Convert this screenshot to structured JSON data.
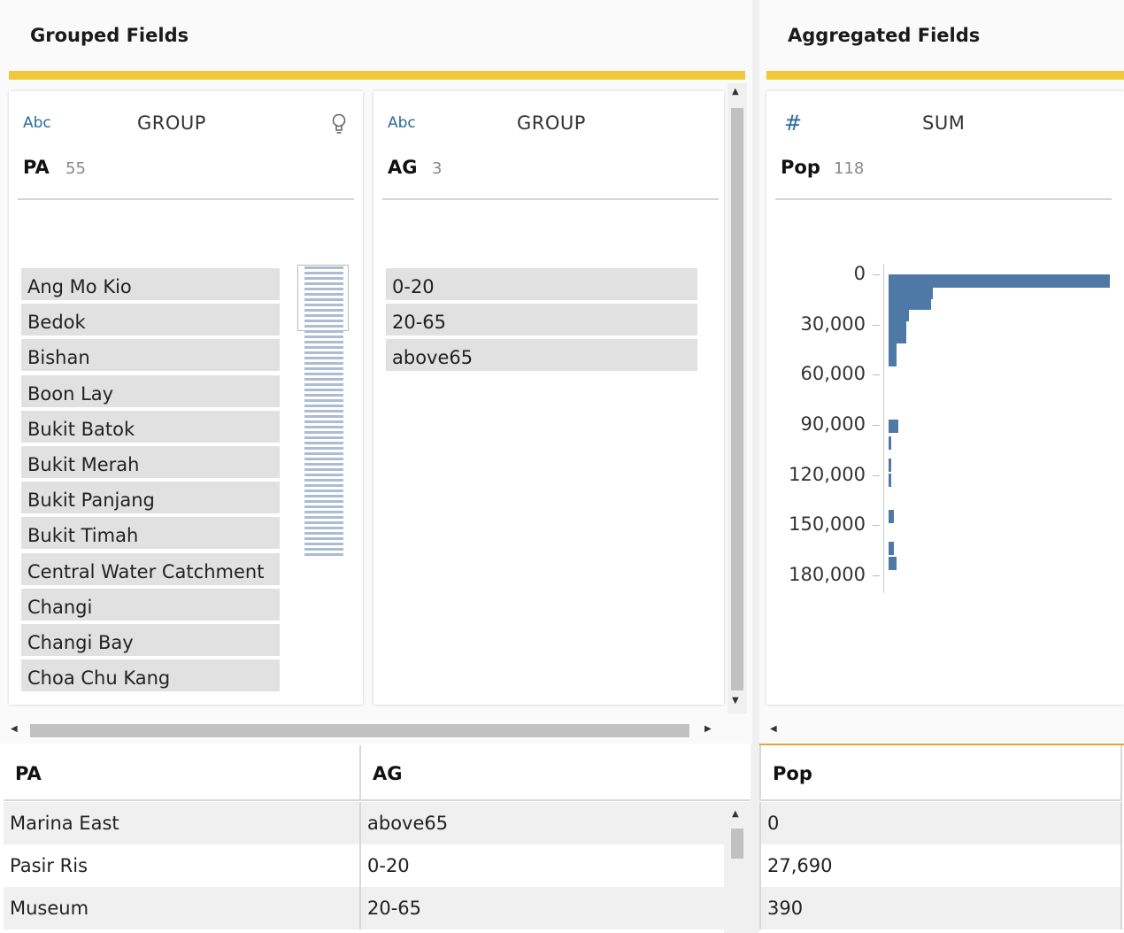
{
  "grouped_panel": {
    "title": "Grouped Fields"
  },
  "aggregated_panel": {
    "title": "Aggregated Fields"
  },
  "cards": {
    "pa": {
      "type": "Abc",
      "aggregation": "GROUP",
      "name": "PA",
      "count": "55",
      "values": [
        "Ang Mo Kio",
        "Bedok",
        "Bishan",
        "Boon Lay",
        "Bukit Batok",
        "Bukit Merah",
        "Bukit Panjang",
        "Bukit Timah",
        "Central Water Catchment",
        "Changi",
        "Changi Bay",
        "Choa Chu Kang"
      ]
    },
    "ag": {
      "type": "Abc",
      "aggregation": "GROUP",
      "name": "AG",
      "count": "3",
      "values": [
        "0-20",
        "20-65",
        "above65"
      ]
    },
    "pop": {
      "type": "#",
      "aggregation": "SUM",
      "name": "Pop",
      "count": "118"
    }
  },
  "chart_data": {
    "type": "bar",
    "orientation": "horizontal",
    "description_of_axis": "binned histogram of Pop values",
    "y_tick_labels": [
      "0",
      "30,000",
      "60,000",
      "90,000",
      "120,000",
      "150,000",
      "180,000"
    ],
    "y_ticks": [
      0,
      30000,
      60000,
      90000,
      120000,
      150000,
      180000
    ],
    "bins": [
      {
        "start": 0,
        "frequency": 1.0
      },
      {
        "start": 6700,
        "frequency": 0.2
      },
      {
        "start": 13400,
        "frequency": 0.19
      },
      {
        "start": 20100,
        "frequency": 0.09
      },
      {
        "start": 26800,
        "frequency": 0.08
      },
      {
        "start": 33500,
        "frequency": 0.08
      },
      {
        "start": 40200,
        "frequency": 0.035
      },
      {
        "start": 46900,
        "frequency": 0.035
      },
      {
        "start": 87000,
        "frequency": 0.045
      },
      {
        "start": 97000,
        "frequency": 0.012
      },
      {
        "start": 110000,
        "frequency": 0.012
      },
      {
        "start": 119000,
        "frequency": 0.012
      },
      {
        "start": 141000,
        "frequency": 0.025
      },
      {
        "start": 160000,
        "frequency": 0.025
      },
      {
        "start": 169000,
        "frequency": 0.035
      }
    ],
    "ylim": [
      0,
      180000
    ]
  },
  "grid": {
    "columns": [
      "PA",
      "AG",
      "Pop"
    ],
    "rows": [
      {
        "pa": "Marina East",
        "ag": "above65",
        "pop": "0"
      },
      {
        "pa": "Pasir Ris",
        "ag": "0-20",
        "pop": "27,690"
      },
      {
        "pa": "Museum",
        "ag": "20-65",
        "pop": "390"
      }
    ]
  },
  "colors": {
    "accent": "#f0c83c",
    "bar": "#4e79a7",
    "type_icon": "#2a6b9a",
    "divider_orange": "#e8a33a"
  }
}
